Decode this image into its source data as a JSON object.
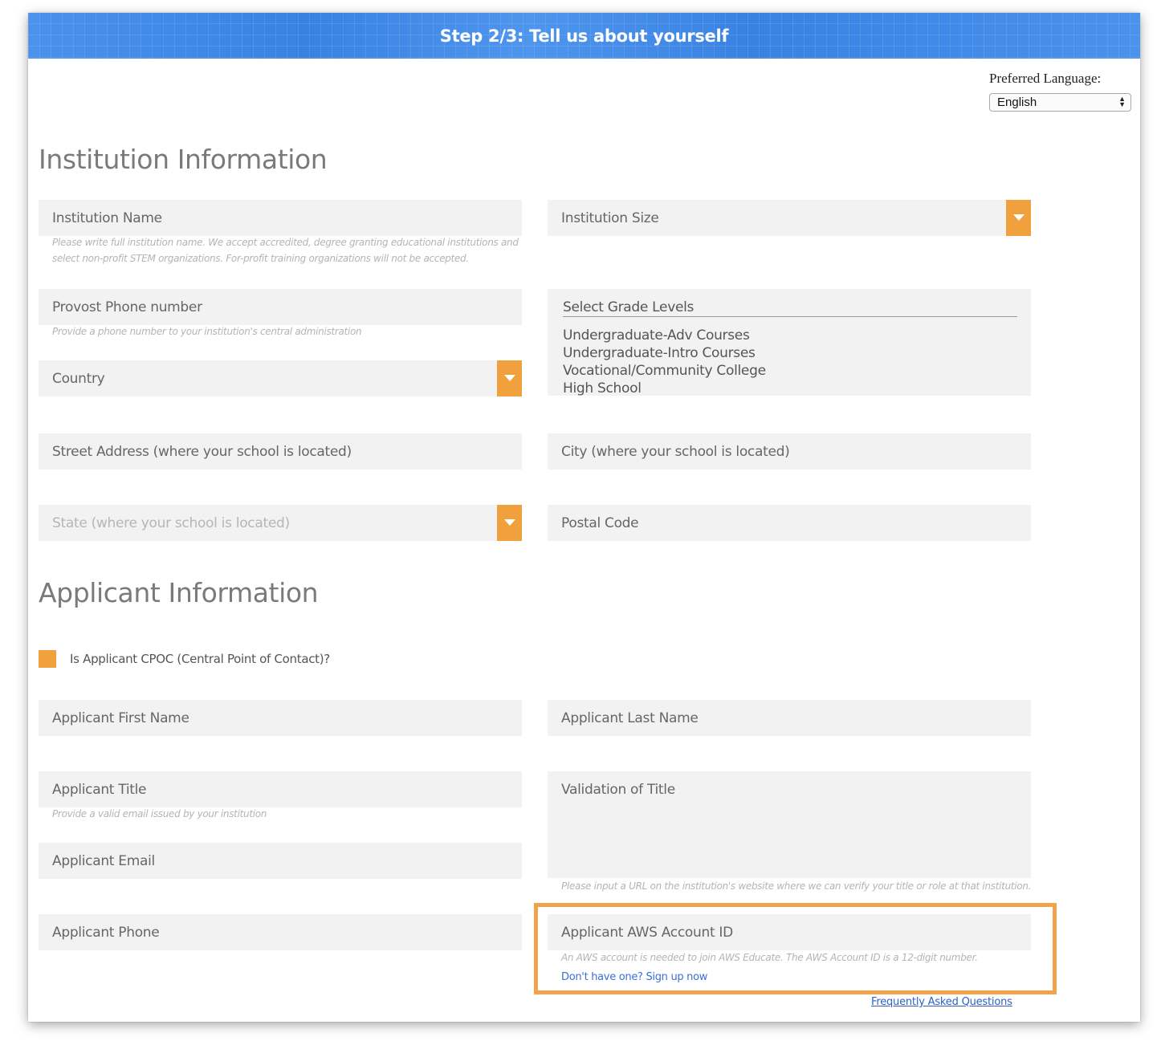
{
  "header": {
    "title": "Step 2/3: Tell us about yourself"
  },
  "language": {
    "label": "Preferred Language:",
    "selected": "English"
  },
  "institution": {
    "heading": "Institution Information",
    "name_label": "Institution Name",
    "name_hint_line1": "Please write full institution name. We accept accredited, degree granting educational institutions and",
    "name_hint_line2": "select non-profit STEM organizations. For-profit training organizations will not be accepted.",
    "size_label": "Institution Size",
    "phone_label": "Provost Phone number",
    "phone_hint": "Provide a phone number to your institution's central administration",
    "country_label": "Country",
    "grade_title": "Select Grade Levels",
    "grade_options": [
      "Undergraduate-Adv Courses",
      "Undergraduate-Intro Courses",
      "Vocational/Community College",
      "High School"
    ],
    "street_label": "Street Address (where your school is located)",
    "city_label": "City (where your school is located)",
    "state_label": "State (where your school is located)",
    "postal_label": "Postal Code"
  },
  "applicant": {
    "heading": "Applicant Information",
    "cpoc_label": "Is Applicant CPOC (Central Point of Contact)?",
    "first_name_label": "Applicant First Name",
    "last_name_label": "Applicant Last Name",
    "title_label": "Applicant Title",
    "title_hint": "Provide a valid email issued by your institution",
    "validation_label": "Validation of Title",
    "validation_hint": "Please input a URL on the institution's website where we can verify your title or role at that institution.",
    "email_label": "Applicant Email",
    "phone_label": "Applicant Phone",
    "aws_label": "Applicant AWS Account ID",
    "aws_hint": "An AWS account is needed to join AWS Educate. The AWS Account ID is a 12-digit number.",
    "aws_signup_link": "Don't have one? Sign up now"
  },
  "footer": {
    "faq_link": "Frequently Asked Questions"
  },
  "colors": {
    "accent": "#f0a13d",
    "banner": "#3f88e6",
    "field_bg": "#f2f2f2"
  }
}
